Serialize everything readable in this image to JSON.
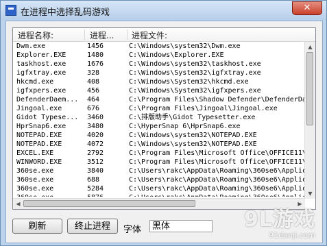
{
  "window": {
    "title": "在进程中选择乱码游戏",
    "close_label": "✕"
  },
  "list": {
    "columns": [
      "进程名称:",
      "进程...",
      "进程文件:"
    ],
    "rows": [
      {
        "name": "Dwm.exe",
        "pid": "1456",
        "path": "C:\\Windows\\system32\\Dwm.exe"
      },
      {
        "name": "Explorer.EXE",
        "pid": "1480",
        "path": "C:\\Windows\\Explorer.EXE"
      },
      {
        "name": "taskhost.exe",
        "pid": "1676",
        "path": "C:\\Windows\\system32\\taskhost.exe"
      },
      {
        "name": "igfxtray.exe",
        "pid": "328",
        "path": "C:\\Windows\\System32\\igfxtray.exe"
      },
      {
        "name": "hkcmd.exe",
        "pid": "408",
        "path": "C:\\Windows\\System32\\hkcmd.exe"
      },
      {
        "name": "igfxpers.exe",
        "pid": "456",
        "path": "C:\\Windows\\System32\\igfxpers.exe"
      },
      {
        "name": "DefenderDaem...",
        "pid": "464",
        "path": "C:\\Program Files\\Shadow Defender\\DefenderDa"
      },
      {
        "name": "Jingoal.exe",
        "pid": "676",
        "path": "C:\\Program Files\\Jingoal\\Jingoal.exe"
      },
      {
        "name": "Gidot Typese...",
        "pid": "3460",
        "path": "C:\\排版助手\\Gidot Typesetter.exe"
      },
      {
        "name": "HprSnap6.exe",
        "pid": "3480",
        "path": "C:\\HyperSnap 6\\HprSnap6.exe"
      },
      {
        "name": "NOTEPAD.EXE",
        "pid": "4020",
        "path": "C:\\Windows\\system32\\NOTEPAD.EXE"
      },
      {
        "name": "NOTEPAD.EXE",
        "pid": "4072",
        "path": "C:\\Windows\\system32\\NOTEPAD.EXE"
      },
      {
        "name": "EXCEL.EXE",
        "pid": "2792",
        "path": "C:\\Program Files\\Microsoft Office\\OFFICE11\\"
      },
      {
        "name": "WINWORD.EXE",
        "pid": "3512",
        "path": "C:\\Program Files\\Microsoft Office\\OFFICE11\\"
      },
      {
        "name": "360se.exe",
        "pid": "3840",
        "path": "C:\\Users\\rakc\\AppData\\Roaming\\360se6\\Applic"
      },
      {
        "name": "360se.exe",
        "pid": "688",
        "path": "C:\\Users\\rakc\\AppData\\Roaming\\360se6\\Applic"
      },
      {
        "name": "360se.exe",
        "pid": "5284",
        "path": "C:\\Users\\rakc\\AppData\\Roaming\\360se6\\Applic"
      },
      {
        "name": "360se.exe",
        "pid": "5876",
        "path": "C:\\Users\\rakc\\AppData\\Roaming\\360se6\\Applic"
      }
    ]
  },
  "footer": {
    "refresh_label": "刷新",
    "end_process_label": "终止进程",
    "font_label": "字体",
    "font_value": "黑体"
  },
  "watermark": {
    "main": "9L游戏",
    "sub": "91danji.com"
  }
}
